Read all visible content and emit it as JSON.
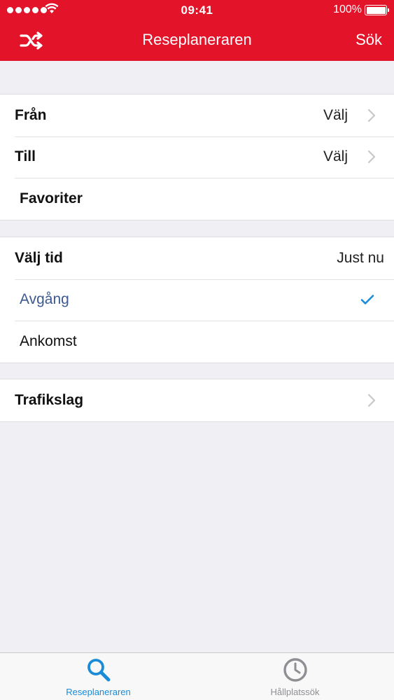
{
  "status_bar": {
    "time": "09:41",
    "battery": "100%"
  },
  "nav": {
    "title": "Reseplaneraren",
    "action": "Sök",
    "left_icon": "shuffle-icon"
  },
  "route_section": {
    "from_label": "Från",
    "from_value": "Välj",
    "to_label": "Till",
    "to_value": "Välj",
    "favorites_label": "Favoriter"
  },
  "time_section": {
    "choose_time_label": "Välj tid",
    "choose_time_value": "Just nu",
    "departure_label": "Avgång",
    "arrival_label": "Ankomst",
    "selected": "departure"
  },
  "mode_section": {
    "transport_label": "Trafikslag"
  },
  "tabbar": {
    "tabs": [
      {
        "label": "Reseplaneraren",
        "icon": "search-icon",
        "active": true
      },
      {
        "label": "Hållplatssök",
        "icon": "clock-icon",
        "active": false
      }
    ]
  },
  "colors": {
    "brand_red": "#e3132a",
    "selected_text": "#3c5990",
    "check_blue": "#1a8bd6",
    "tab_active": "#1a8bd6",
    "tab_inactive": "#8e8e93",
    "background": "#efeff4"
  }
}
